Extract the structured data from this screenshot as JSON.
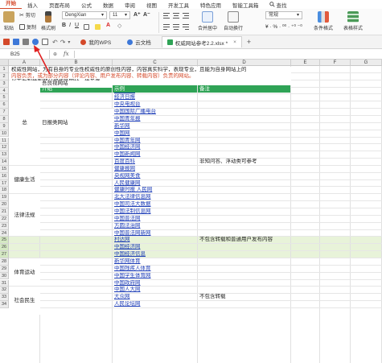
{
  "menu": {
    "tabs": [
      "开始",
      "插入",
      "页面布局",
      "公式",
      "数据",
      "审阅",
      "视图",
      "开发工具",
      "特色应用",
      "智能工具箱"
    ],
    "active": "开始",
    "search_label": "查找"
  },
  "ribbon": {
    "cut": "剪切",
    "copy": "复制",
    "format_painter": "格式刷",
    "paste": "粘贴",
    "font_name": "DengXian",
    "font_size": "11",
    "merge_center": "合并居中",
    "wrap": "自动换行",
    "number_format": "常规",
    "cond_format": "条件格式",
    "table_style": "表格样式"
  },
  "doc_tabs": [
    {
      "label": "我的WPS",
      "current": false
    },
    {
      "label": "云文档",
      "current": false
    },
    {
      "label": "权威网站参考2.2.xlsx *",
      "current": true
    }
  ],
  "formula_bar": {
    "cell_ref": "B25",
    "fx": "fx",
    "value": ""
  },
  "columns": [
    "A",
    "B",
    "C",
    "D",
    "E",
    "F",
    "G"
  ],
  "intro": {
    "line1": "权威性网站，为有自身的专业性权威性的原创性内容，内容真实科学，表现专业，且能为自身网站上的",
    "line2": "内容负责，或为部分内容（评论内容、用户发布内容、转载内容）负责的网站。",
    "line3": "以下为列举到部分权威性网站，供参考"
  },
  "header_row": {
    "a": "分类",
    "b": "介绍",
    "c": "示例",
    "d": "备注"
  },
  "categories": [
    {
      "label": "总",
      "sub": "吾良视网站"
    },
    {
      "label": "",
      "sub": "日报类网站"
    },
    {
      "label": "健康生活",
      "sub": ""
    },
    {
      "label": "法律法规",
      "sub": ""
    },
    {
      "label": "体育运动",
      "sub": ""
    },
    {
      "label": "社会民生",
      "sub": ""
    }
  ],
  "rows": [
    {
      "n": "1",
      "c": "",
      "d": ""
    },
    {
      "n": "2",
      "c": "示例",
      "d": "备注"
    },
    {
      "n": "3",
      "c": "人民网",
      "d": ""
    },
    {
      "n": "4",
      "c": "光明日报",
      "d": ""
    },
    {
      "n": "5",
      "c": "经济日报",
      "d": ""
    },
    {
      "n": "6",
      "c": "中央电视台",
      "d": ""
    },
    {
      "n": "7",
      "c": "中国国际广播电台",
      "d": ""
    },
    {
      "n": "8",
      "c": "中国青年报",
      "d": ""
    },
    {
      "n": "9",
      "c": "新华网",
      "d": ""
    },
    {
      "n": "10",
      "c": "中国网",
      "d": ""
    },
    {
      "n": "11",
      "c": "中国青年网",
      "d": ""
    },
    {
      "n": "12",
      "c": "中国经济网",
      "d": ""
    },
    {
      "n": "13",
      "c": "中国新闻网",
      "d": ""
    },
    {
      "n": "14",
      "c": "百度百科",
      "d": "非知问答、浮动类可参考"
    },
    {
      "n": "15",
      "c": "健康报网",
      "d": ""
    },
    {
      "n": "16",
      "c": "央视网美食",
      "d": ""
    },
    {
      "n": "17",
      "c": "人民健康网",
      "d": ""
    },
    {
      "n": "18",
      "c": "健康时报 人民网",
      "d": ""
    },
    {
      "n": "19",
      "c": "北大法律信息网",
      "d": ""
    },
    {
      "n": "20",
      "c": "中国司法大数据",
      "d": ""
    },
    {
      "n": "21",
      "c": "中国法制信息网",
      "d": ""
    },
    {
      "n": "22",
      "c": "中国普法网",
      "d": ""
    },
    {
      "n": "23",
      "c": "方圆法治网",
      "d": ""
    },
    {
      "n": "24",
      "c": "中国普法网新网",
      "d": ""
    },
    {
      "n": "25",
      "c": "村达网",
      "d": "不包含转载和普通用户发布内容"
    },
    {
      "n": "26",
      "c": "中国经济网",
      "d": ""
    },
    {
      "n": "27",
      "c": "中国经济信息",
      "d": ""
    },
    {
      "n": "28",
      "c": "新华网体育",
      "d": ""
    },
    {
      "n": "29",
      "c": "中国残疾人体育",
      "d": ""
    },
    {
      "n": "30",
      "c": "中国学生体育网",
      "d": ""
    },
    {
      "n": "31",
      "c": "中国政府网",
      "d": ""
    },
    {
      "n": "32",
      "c": "中国人大网",
      "d": ""
    },
    {
      "n": "33",
      "c": "大众网",
      "d": "不包含转载"
    },
    {
      "n": "34",
      "c": "人民论坛网",
      "d": ""
    }
  ],
  "colors": {
    "accent": "#d4492a",
    "header_green": "#2fa356",
    "link_blue": "#1d3db7",
    "selection": "#e8f3d9",
    "arrow": "#e02020"
  }
}
